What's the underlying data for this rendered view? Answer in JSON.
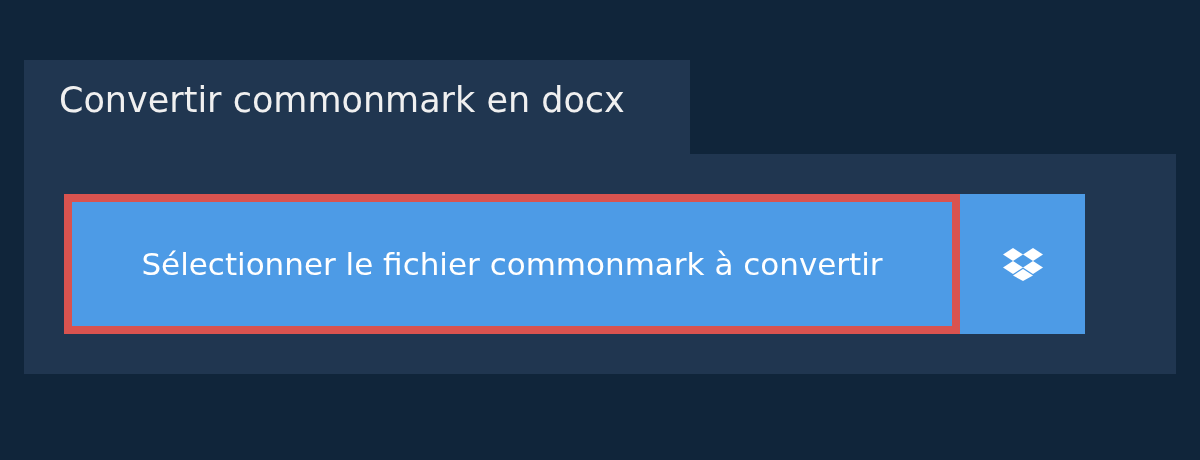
{
  "tab": {
    "title": "Convertir commonmark en docx"
  },
  "select_button": {
    "label": "Sélectionner le fichier commonmark à convertir",
    "focused": true
  }
}
